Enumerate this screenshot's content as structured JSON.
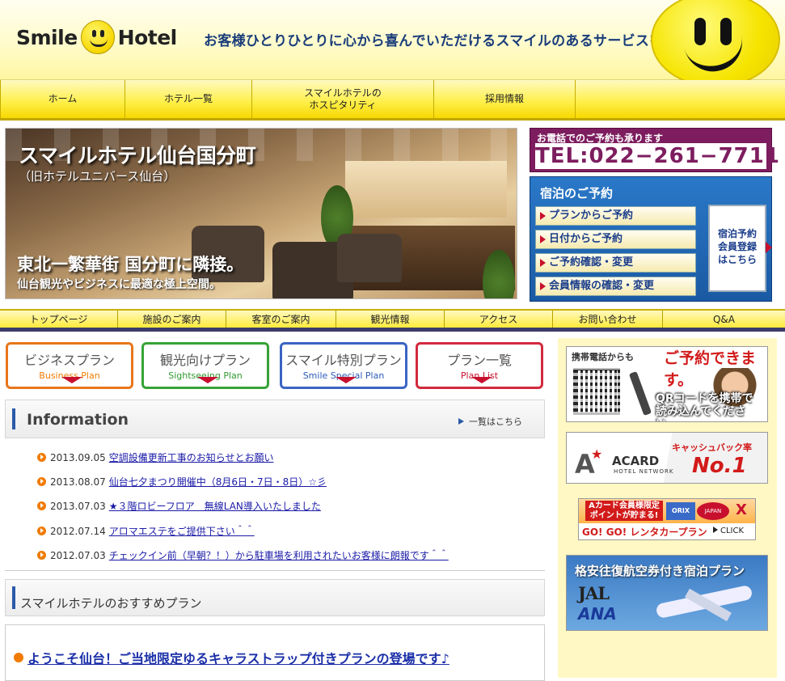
{
  "header": {
    "logo_word1": "Smile",
    "logo_word2": "Hotel",
    "tagline": "お客様ひとりひとりに心から喜んでいただけるスマイルのあるサービスを。"
  },
  "top_nav": [
    {
      "label": "ホーム"
    },
    {
      "label": "ホテル一覧"
    },
    {
      "label": "スマイルホテルの\nホスピタリティ"
    },
    {
      "label": "採用情報"
    },
    {
      "label": ""
    }
  ],
  "hero": {
    "title": "スマイルホテル仙台国分町",
    "subtitle": "（旧ホテルユニバース仙台）",
    "catch": "東北一繁華街 国分町に隣接。",
    "catch_sub": "仙台観光やビジネスに最適な極上空間。"
  },
  "phone": {
    "label": "お電話でのご予約も承ります",
    "number": "TEL:022−261−7711"
  },
  "reservation": {
    "title": "宿泊のご予約",
    "buttons": [
      "プランからご予約",
      "日付からご予約",
      "ご予約確認・変更",
      "会員情報の確認・変更"
    ],
    "member": "宿泊予約\n会員登録\nはこちら"
  },
  "nav2": [
    "トップページ",
    "施設のご案内",
    "客室のご案内",
    "観光情報",
    "アクセス",
    "お問い合わせ",
    "Q&A"
  ],
  "plans": [
    {
      "jp": "ビジネスプラン",
      "en": "Business Plan",
      "color": "#f07b00",
      "border": "#e8761a"
    },
    {
      "jp": "観光向けプラン",
      "en": "Sightseeing Plan",
      "color": "#2f9a2f",
      "border": "#36a336"
    },
    {
      "jp": "スマイル特別プラン",
      "en": "Smile Special Plan",
      "color": "#2c5bb8",
      "border": "#3a64c4"
    },
    {
      "jp": "プラン一覧",
      "en": "Plan List",
      "color": "#c8102e",
      "border": "#d22a3e"
    }
  ],
  "info": {
    "title": "Information",
    "more": "一覧はこちら",
    "news": [
      {
        "date": "2013.09.05",
        "title": "空調設備更新工事のお知らせとお願い"
      },
      {
        "date": "2013.08.07",
        "title": "仙台七夕まつり開催中（8月6日・7日・8日）☆彡"
      },
      {
        "date": "2013.07.03",
        "title": "★３階ロビーフロア　無線LAN導入いたしました"
      },
      {
        "date": "2012.07.14",
        "title": "アロマエステをご提供下さい＾＾"
      },
      {
        "date": "2012.07.03",
        "title": "チェックイン前（早朝？！）から駐車場を利用されたいお客様に朗報です＾＾"
      }
    ]
  },
  "recommend": {
    "title": "スマイルホテルのおすすめプラン",
    "item": "ようこそ仙台！ご当地限定ゆるキャラストラップ付きプランの登場です♪"
  },
  "sidebar": {
    "mobile": {
      "line1": "携帯電話からも",
      "line2": "ご予約できます。",
      "qr_text": "QRコードを携帯で\n読み込んでください。"
    },
    "acard": {
      "brand": "ACARD",
      "sub": "HOTEL NETWORK",
      "cashback": "キャッシュバック率",
      "no1": "No.1"
    },
    "rental": {
      "badge": "Aカード会員様限定\nポイントが貯まる!",
      "logo1": "ORIX",
      "logo2": "JAPAN",
      "logo3": "X",
      "banner": "GO! GO! レンタカープラン",
      "click": "CLICK"
    },
    "flight": {
      "title": "格安往復航空券付き宿泊プラン",
      "jal": "JAL",
      "ana": "ANA"
    }
  }
}
